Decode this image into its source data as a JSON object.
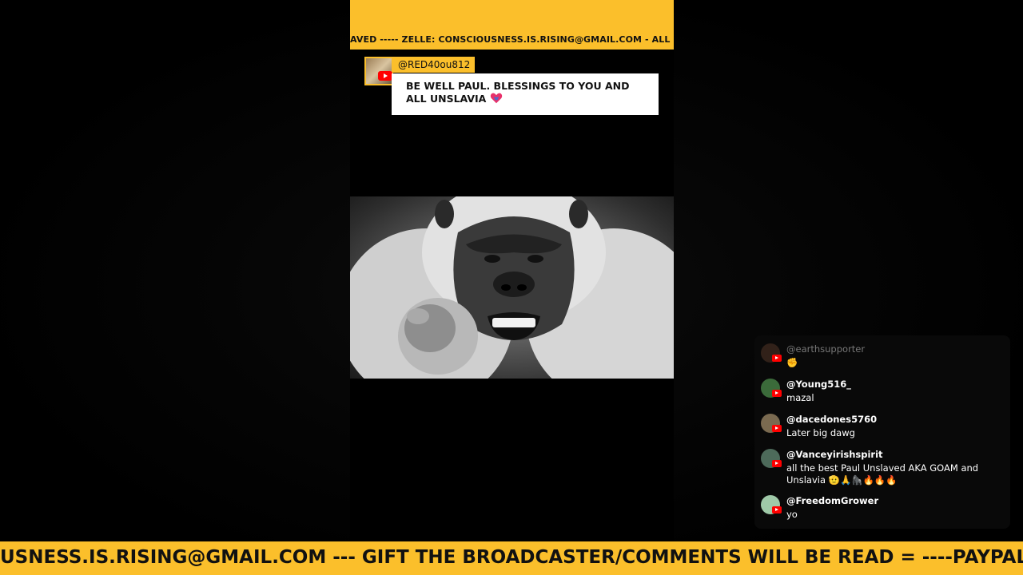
{
  "top_ticker": {
    "text": "AVED ----- ZELLE: CONSCIOUSNESS.IS.RISING@GMAIL.COM - ALL MATERI"
  },
  "featured_comment": {
    "username": "@RED40ou812",
    "text": "BE WELL PAUL. BLESSINGS TO YOU AND ALL UNSLAVIA",
    "emoji": "heart-icon"
  },
  "video": {
    "subject_icon": "gorilla-image"
  },
  "chat": {
    "messages": [
      {
        "author": "@earthsupporter",
        "text": "✊",
        "avatar_color": "#5a3a2a",
        "faded": true
      },
      {
        "author": "@Young516_",
        "text": "mazal",
        "avatar_color": "#3b6b3a"
      },
      {
        "author": "@dacedones5760",
        "text": "Later big dawg",
        "avatar_color": "#7a6a50"
      },
      {
        "author": "@Vanceyirishspirit",
        "text": "all the best Paul Unslaved AKA GOAM and Unslavia 🫡🙏🦍🔥🔥🔥",
        "avatar_color": "#4d6a5a"
      },
      {
        "author": "@FreedomGrower",
        "text": "yo",
        "avatar_color": "#9fc9a8"
      }
    ]
  },
  "bottom_ticker": {
    "text": "USNESS.IS.RISING@GMAIL.COM --- GIFT THE BROADCASTER/COMMENTS WILL BE READ = ----PAYPAL:"
  },
  "colors": {
    "banner": "#fbbf2b",
    "youtube_red": "#ff0000"
  }
}
